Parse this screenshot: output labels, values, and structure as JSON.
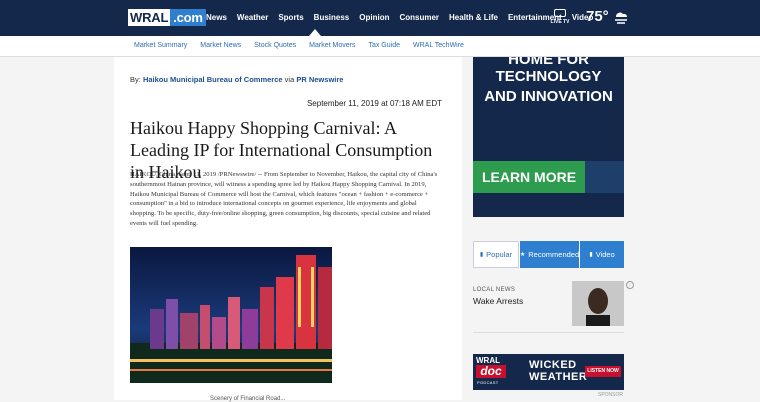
{
  "header": {
    "logo_left": "WRAL",
    "logo_right": ".com",
    "nav": [
      "News",
      "Weather",
      "Sports",
      "Business",
      "Opinion",
      "Consumer",
      "Health & Life",
      "Entertainment",
      "Video"
    ],
    "active_nav": "Business",
    "live_tv": "LIVE TV",
    "temperature": "75°",
    "weather_icon": "cloud-wind-icon"
  },
  "subnav": [
    "Market Summary",
    "Market News",
    "Stock Quotes",
    "Market Movers",
    "Tax Guide",
    "WRAL TechWire"
  ],
  "article": {
    "by": "By:",
    "source": "Haikou Municipal Bureau of Commerce",
    "via": "via",
    "wire": "PR Newswire",
    "date": "September 11, 2019 at 07:18 AM EDT",
    "headline": "Haikou Happy Shopping Carnival: A Leading IP for International Consumption in Haikou",
    "body": "HAIKOU, China, Sept. 11, 2019 /PRNewswire/ -- From September to November, Haikou, the capital city of China's southernmost Hainan province, will witness a spending spree led by Haikou Happy Shopping Carnival. In 2019, Haikou Municipal Bureau of Commerce will host the Carnival, which features \"ocean + fashion + e-commerce + consumption\" in a bid to introduce international concepts on gourmet experience, life enjoyments and global shopping. To be specific, duty-free/online shopping, green consumption, big discounts, special cuisine and related events will fuel spending.",
    "caption": "Scenery of Financial Road..."
  },
  "sidebar": {
    "ad1": {
      "line1": "HOME FOR",
      "line2": "TECHNOLOGY",
      "line3": "AND INNOVATION",
      "cta": "LEARN MORE"
    },
    "tabs": [
      {
        "label": "Popular",
        "icon": "bar-chart-icon"
      },
      {
        "label": "Recommended",
        "icon": "star-icon"
      },
      {
        "label": "Video",
        "icon": "bar-chart-icon"
      }
    ],
    "local": {
      "category": "LOCAL NEWS",
      "title": "Wake Arrests"
    },
    "ad2": {
      "brand": "WRAL",
      "doc": "doc",
      "podcast": "PODCAST",
      "tag1": "WICKED",
      "tag2": "WEATHER",
      "listen": "LISTEN NOW"
    },
    "sponsor": "SPONSOR"
  },
  "colors": {
    "header_bg": "#13284a",
    "accent_blue": "#2e7fd0",
    "cta_green": "#2e9c4f",
    "link_blue": "#2e6db0"
  }
}
